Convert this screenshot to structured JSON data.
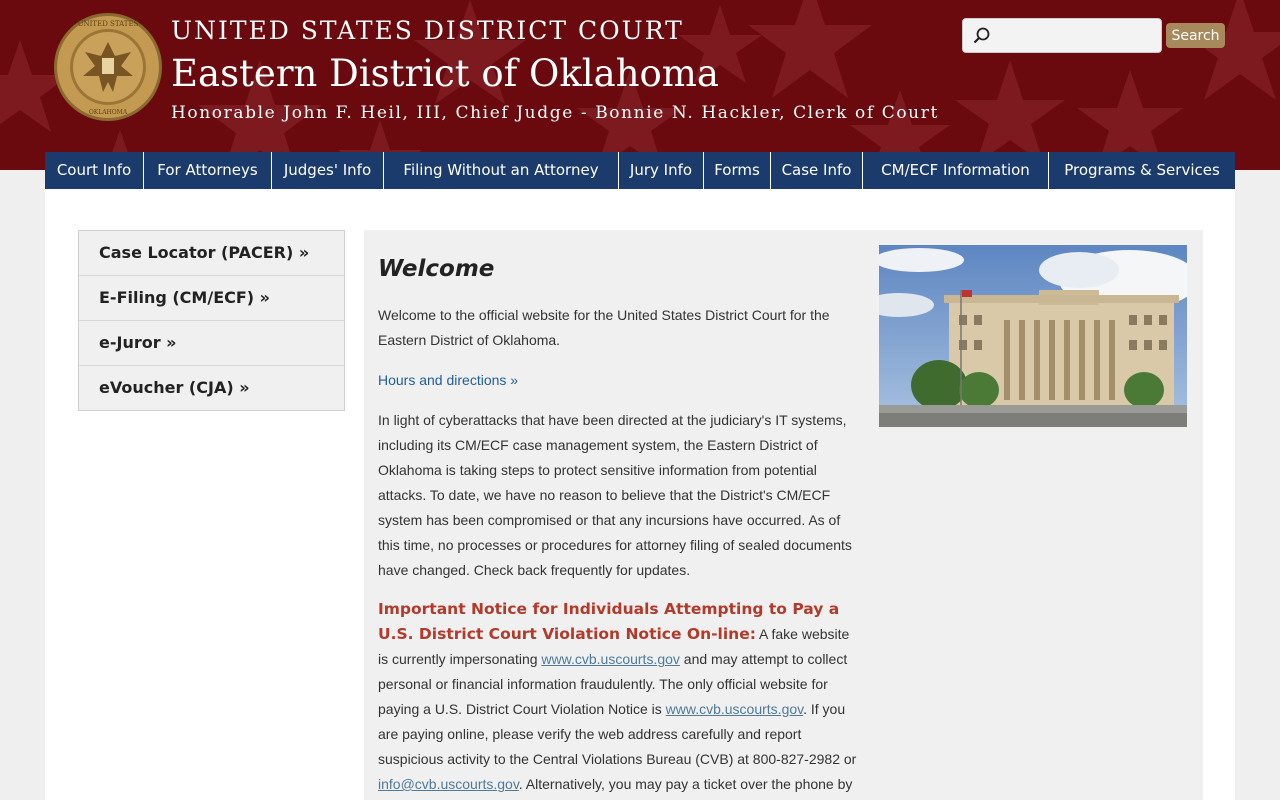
{
  "header": {
    "line1": "UNITED STATES DISTRICT COURT",
    "line2": "Eastern District of Oklahoma",
    "line3": "Honorable John F. Heil, III, Chief Judge - Bonnie N. Hackler, Clerk of Court",
    "seal_icon": "court-seal-icon",
    "seal_text_top": "UNITED STATES DISTRICT COURT",
    "seal_text_bottom": "EASTERN DISTRICT OF OKLAHOMA",
    "background_color": "#6b0a0e"
  },
  "search": {
    "placeholder": "",
    "button_label": "Search",
    "icon": "search-icon"
  },
  "nav": {
    "items": [
      "Court Info",
      "For Attorneys",
      "Judges' Info",
      "Filing Without an Attorney",
      "Jury Info",
      "Forms",
      "Case Info",
      "CM/ECF Information",
      "Programs & Services"
    ],
    "color": "#1a3b6b"
  },
  "sidebar": {
    "items": [
      "Case Locator (PACER) »",
      "E-Filing (CM/ECF) »",
      "e-Juror »",
      "eVoucher (CJA) »"
    ]
  },
  "content": {
    "title": "Welcome",
    "intro": "Welcome to the official website for the United States District Court for the Eastern District of Oklahoma.",
    "hours_link": "Hours and directions »",
    "cyber_notice": "In light of cyberattacks that have been directed at the judiciary's IT systems, including its CM/ECF case management system, the Eastern District of Oklahoma is taking steps to protect sensitive information from potential attacks.  To date, we have no reason to believe that the District's CM/ECF system has been compromised or that any incursions have occurred.  As of this time, no processes or procedures for attorney filing of sealed documents have changed.  Check back frequently for updates.",
    "notice_heading": "Important Notice for Individuals Attempting to Pay a U.S. District Court Violation Notice On-line:",
    "notice_part1": " A fake website is currently impersonating ",
    "notice_link1": "www.cvb.uscourts.gov",
    "notice_part2": " and may attempt to collect personal or financial information fraudulently. The only official website for paying a U.S. District Court Violation Notice is ",
    "notice_link2": "www.cvb.uscourts.gov",
    "notice_part3": ". If you are paying online, please verify the web address carefully and report suspicious activity to the Central Violations Bureau (CVB) at 800-827-2982 or ",
    "notice_link3": "info@cvb.uscourts.gov",
    "notice_part4": ". Alternatively, you may pay a ticket over the phone by",
    "photo": "courthouse-photo"
  }
}
